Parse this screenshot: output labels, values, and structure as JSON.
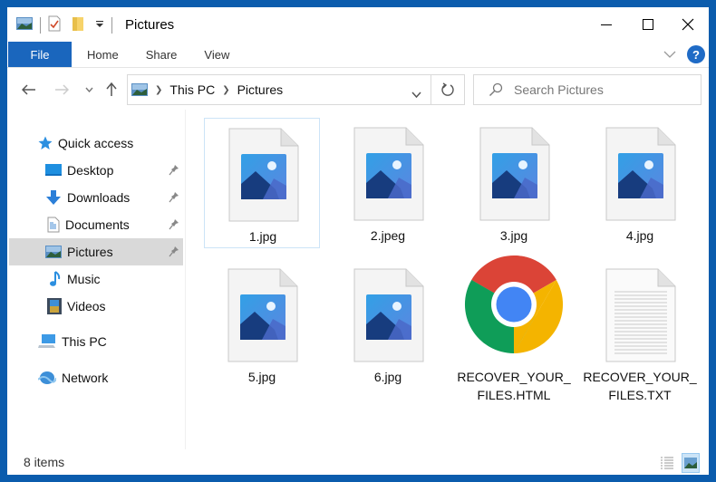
{
  "window": {
    "title": "Pictures",
    "controls": {
      "minimize": "minimize",
      "maximize": "maximize",
      "close": "close"
    }
  },
  "quick_access_toolbar": {
    "icons": [
      "pictures-icon",
      "properties-icon",
      "new-folder-icon",
      "customize-dropdown-icon"
    ]
  },
  "ribbon": {
    "tabs": [
      {
        "label": "File",
        "active": true
      },
      {
        "label": "Home"
      },
      {
        "label": "Share"
      },
      {
        "label": "View"
      }
    ],
    "help_label": "?"
  },
  "navigation": {
    "breadcrumb": [
      "This PC",
      "Pictures"
    ],
    "search_placeholder": "Search Pictures"
  },
  "sidebar": {
    "items": [
      {
        "label": "Quick access",
        "icon": "star-icon",
        "pinned": false
      },
      {
        "label": "Desktop",
        "icon": "desktop-icon",
        "pinned": true
      },
      {
        "label": "Downloads",
        "icon": "download-icon",
        "pinned": true
      },
      {
        "label": "Documents",
        "icon": "documents-icon",
        "pinned": true
      },
      {
        "label": "Pictures",
        "icon": "pictures-icon",
        "pinned": true,
        "selected": true
      },
      {
        "label": "Music",
        "icon": "music-icon",
        "pinned": false
      },
      {
        "label": "Videos",
        "icon": "videos-icon",
        "pinned": false
      },
      {
        "label": "This PC",
        "icon": "computer-icon",
        "pinned": false
      },
      {
        "label": "Network",
        "icon": "network-icon",
        "pinned": false
      }
    ]
  },
  "files": [
    {
      "name": "1.jpg",
      "line1": "1.jpg",
      "line2": "",
      "type": "image"
    },
    {
      "name": "2.jpeg",
      "line1": "2.jpeg",
      "line2": "",
      "type": "image"
    },
    {
      "name": "3.jpg",
      "line1": "3.jpg",
      "line2": "",
      "type": "image"
    },
    {
      "name": "4.jpg",
      "line1": "4.jpg",
      "line2": "",
      "type": "image"
    },
    {
      "name": "5.jpg",
      "line1": "5.jpg",
      "line2": "",
      "type": "image"
    },
    {
      "name": "6.jpg",
      "line1": "6.jpg",
      "line2": "",
      "type": "image"
    },
    {
      "name": "RECOVER_YOUR_FILES.HTML",
      "line1": "RECOVER_YOUR_",
      "line2": "FILES.HTML",
      "type": "html"
    },
    {
      "name": "RECOVER_YOUR_FILES.TXT",
      "line1": "RECOVER_YOUR_",
      "line2": "FILES.TXT",
      "type": "text"
    }
  ],
  "status": {
    "item_count": "8 items"
  },
  "colors": {
    "accent": "#1a66bd",
    "frame": "#0b5cad",
    "selection": "#cce4f7"
  }
}
